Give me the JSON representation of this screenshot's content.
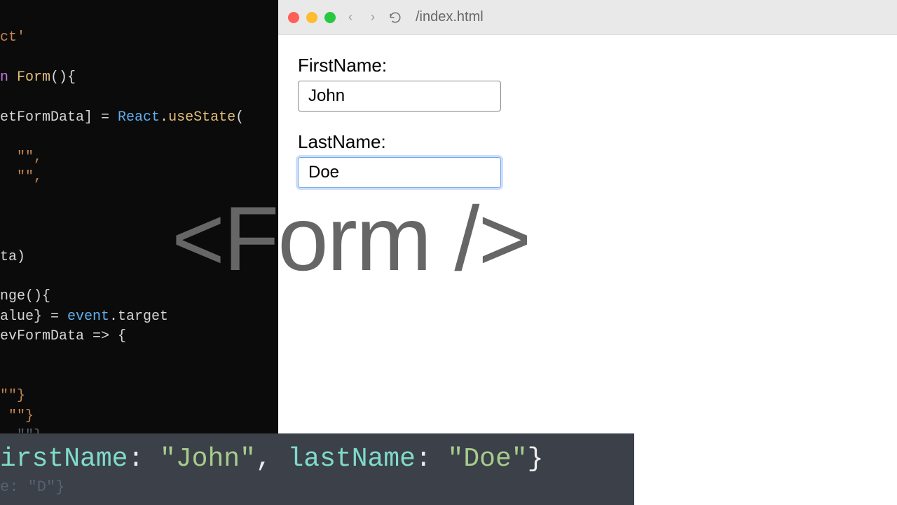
{
  "editor": {
    "l1": "ct'",
    "l2_kw": "n ",
    "l2_fn": "Form",
    "l2_tail": "(){",
    "l3a": "etFormData] = ",
    "l3b": "React",
    "l3c": ".",
    "l3d": "useState",
    "l3e": "(",
    "l4": "\"\",",
    "l5": "\"\",",
    "l6": "ta)",
    "l7": "nge(){",
    "l8a": "alue} = ",
    "l8b": "event",
    "l8c": ".target",
    "l9": "evFormData => {",
    "l10": "\"\"}",
    "l11": " \"\"}",
    "l12": "  \"\"}"
  },
  "browser": {
    "url": "/index.html",
    "form": {
      "firstNameLabel": "FirstName:",
      "firstNameValue": "John",
      "lastNameLabel": "LastName:",
      "lastNameValue": "Doe"
    }
  },
  "overlay": {
    "title": "<Form />"
  },
  "console": {
    "k1": "irstName",
    "v1": "\"John\"",
    "k2": "lastName",
    "v2": "\"Doe\"",
    "sep1": ": ",
    "sep2": ", ",
    "sep3": ": ",
    "tail": "}",
    "dimline": "e: \"D\"}"
  }
}
